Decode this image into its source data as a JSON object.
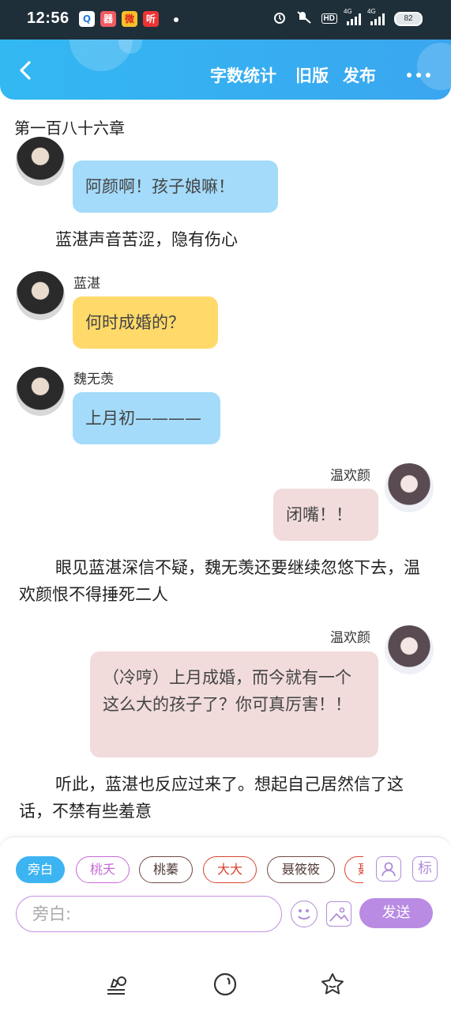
{
  "status_bar": {
    "time": "12:56",
    "apps": [
      "Q",
      "器",
      "微",
      "听"
    ],
    "hd": "HD",
    "net1": "4G",
    "net2": "4G",
    "battery": "82"
  },
  "header": {
    "back_icon": "chevron-left-icon",
    "word_count": "字数统计",
    "old_version": "旧版",
    "publish": "发布",
    "more_icon": "more-dots-icon"
  },
  "chapter_title": "第一百八十六章",
  "messages": [
    {
      "type": "bubble",
      "speaker": "",
      "text": "阿颜啊！孩子娘嘛！",
      "color": "#a4dbfa"
    },
    {
      "type": "narration",
      "text": "蓝湛声音苦涩，隐有伤心"
    },
    {
      "type": "bubble",
      "speaker": "蓝湛",
      "text": "何时成婚的？",
      "color": "#ffda6a"
    },
    {
      "type": "bubble",
      "speaker": "魏无羡",
      "text": "上月初————",
      "color": "#a4dbfa"
    },
    {
      "type": "bubble",
      "speaker": "温欢颜",
      "text": "闭嘴！！",
      "color": "#f1dbdb"
    },
    {
      "type": "narration",
      "text": "眼见蓝湛深信不疑，魏无羡还要继续忽悠下去，温欢颜恨不得捶死二人"
    },
    {
      "type": "bubble",
      "speaker": "温欢颜",
      "text": "（冷哼）上月成婚，而今就有一个这么大的孩子了？你可真厉害！！",
      "color": "#f1dbdb"
    },
    {
      "type": "narration",
      "text": "听此，蓝湛也反应过来了。想起自己居然信了这话，不禁有些羞意"
    }
  ],
  "panel": {
    "chips": [
      "旁白",
      "桃夭",
      "桃蓁",
      "大大",
      "聂筱筱",
      "聂"
    ],
    "role_icon": "person-card-icon",
    "tag_button": "标",
    "input_placeholder": "旁白:",
    "emoji_icon": "smiley-icon",
    "image_icon": "image-icon",
    "send": "发送"
  },
  "bottom_nav": [
    "write-icon",
    "compass-icon",
    "star-icon"
  ]
}
